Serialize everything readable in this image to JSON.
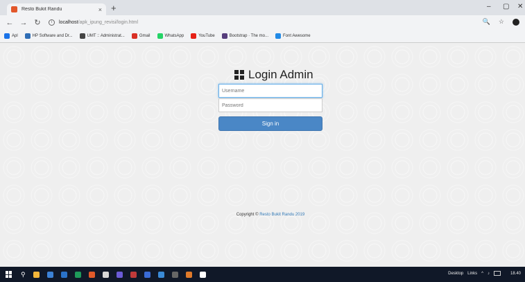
{
  "browser": {
    "tab_title": "Resto Bukit Randu",
    "tab_close": "×",
    "new_tab": "+",
    "url_host": "localhost",
    "url_path": "/apk_ipung_revisi/login.html",
    "info": "i"
  },
  "bookmarks": [
    {
      "label": "Apl",
      "color": "#1a73e8"
    },
    {
      "label": "HP Software and Dr...",
      "color": "#2f6db5"
    },
    {
      "label": "UMT :: Administrat...",
      "color": "#444444"
    },
    {
      "label": "Gmail",
      "color": "#d93025"
    },
    {
      "label": "WhatsApp",
      "color": "#25d366"
    },
    {
      "label": "YouTube",
      "color": "#e62117"
    },
    {
      "label": "Bootstrap · The mo...",
      "color": "#563d7c"
    },
    {
      "label": "Font Awesome",
      "color": "#228ae6"
    }
  ],
  "login": {
    "title": "Login Admin",
    "username_placeholder": "Username",
    "password_placeholder": "Password",
    "signin_label": "Sign in"
  },
  "footer": {
    "copyright_prefix": "Copyright © ",
    "copyright_link": "Resto Bukit Randu 2019"
  },
  "taskbar": {
    "icons": [
      "#f3b63a",
      "#3c82d6",
      "#2a72c9",
      "#1e9a5a",
      "#e05a2a",
      "#d8d8d8",
      "#6b5bd6",
      "#c03a3a",
      "#3a6bd6",
      "#3a8ad6",
      "#666666",
      "#e07a2a",
      "#ffffff"
    ],
    "tray_desktop": "Desktop",
    "tray_links": "Links",
    "clock": "18.40"
  },
  "colors": {
    "accent": "#4a87c6",
    "link": "#337ab7"
  }
}
